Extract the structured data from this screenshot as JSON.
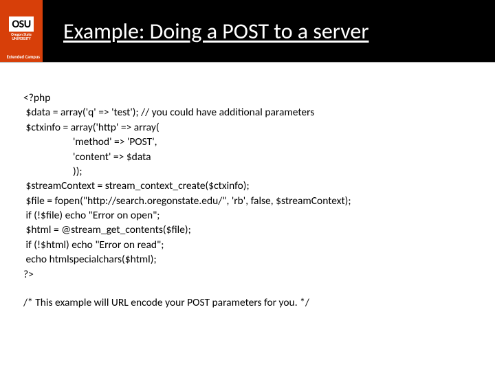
{
  "logo": {
    "abbrev": "OSU",
    "university_line1": "Oregon State",
    "university_line2": "UNIVERSITY",
    "campus": "Extended Campus"
  },
  "title": "Example: Doing a POST to a server",
  "code": {
    "l1": "<?php",
    "l2": " $data = array('q' => 'test'); // you could have additional parameters",
    "l3": " $ctxinfo = array('http' => array(",
    "l4": "'method' => 'POST',",
    "l5": "'content' => $data",
    "l6": "));",
    "l7": " $streamContext = stream_context_create($ctxinfo);",
    "l8": " $file = fopen(\"http://search.oregonstate.edu/\", 'rb', false, $streamContext);",
    "l9": " if (!$file) echo \"Error on open\";",
    "l10": " $html = @stream_get_contents($file);",
    "l11": " if (!$html) echo \"Error on read\";",
    "l12": " echo htmlspecialchars($html);",
    "l13": "?>"
  },
  "comment": "/* This example will URL encode your POST parameters for you. */"
}
